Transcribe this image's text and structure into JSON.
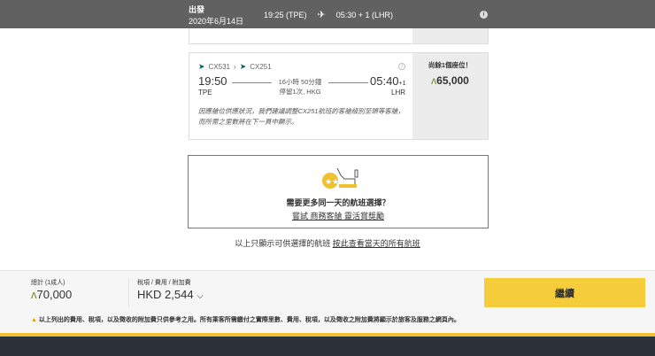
{
  "header": {
    "label": "出發",
    "date": "2020年6月14日",
    "depart": "19:25 (TPE)",
    "arrive": "05:30 + 1 (LHR)"
  },
  "flight": {
    "segments": [
      "CX531",
      "CX251"
    ],
    "dep_time": "19:50",
    "dep_code": "TPE",
    "arr_time": "05:40",
    "arr_plus": "+1",
    "arr_code": "LHR",
    "duration": "16小時 50分鐘",
    "stops": "停留1次, HKG",
    "note": "因應艙位供應狀況，我們建議調整CX251航班的客艙級別至頭等客艙，而所需之里數將在下一頁中顯示。",
    "seats": "尚餘1個座位！",
    "price": "65,000",
    "miles_symbol": "ʌ"
  },
  "promo": {
    "question": "需要更多同一天的航班選擇？",
    "link": "嘗試 商務客艙 靈活賞獎勵"
  },
  "availability": {
    "text": "以上只顯示可供選擇的航班",
    "link": "按此查看當天的所有航班"
  },
  "bottom": {
    "total_label": "總計 (1成人)",
    "total": "70,000",
    "tax_label": "稅項 / 費用 / 附加費",
    "tax": "HKD 2,544",
    "continue": "繼續",
    "disclaimer": "以上列出的費用、稅項，以及徵收的附加費只供參考之用。所有乘客所需繳付之實際里數、費用、稅項，以及徵收之附加費將顯示於旅客及服務之網頁內。"
  },
  "colors": {
    "accent": "#f5cc3a",
    "header": "#616161",
    "brand": "#00645a"
  }
}
